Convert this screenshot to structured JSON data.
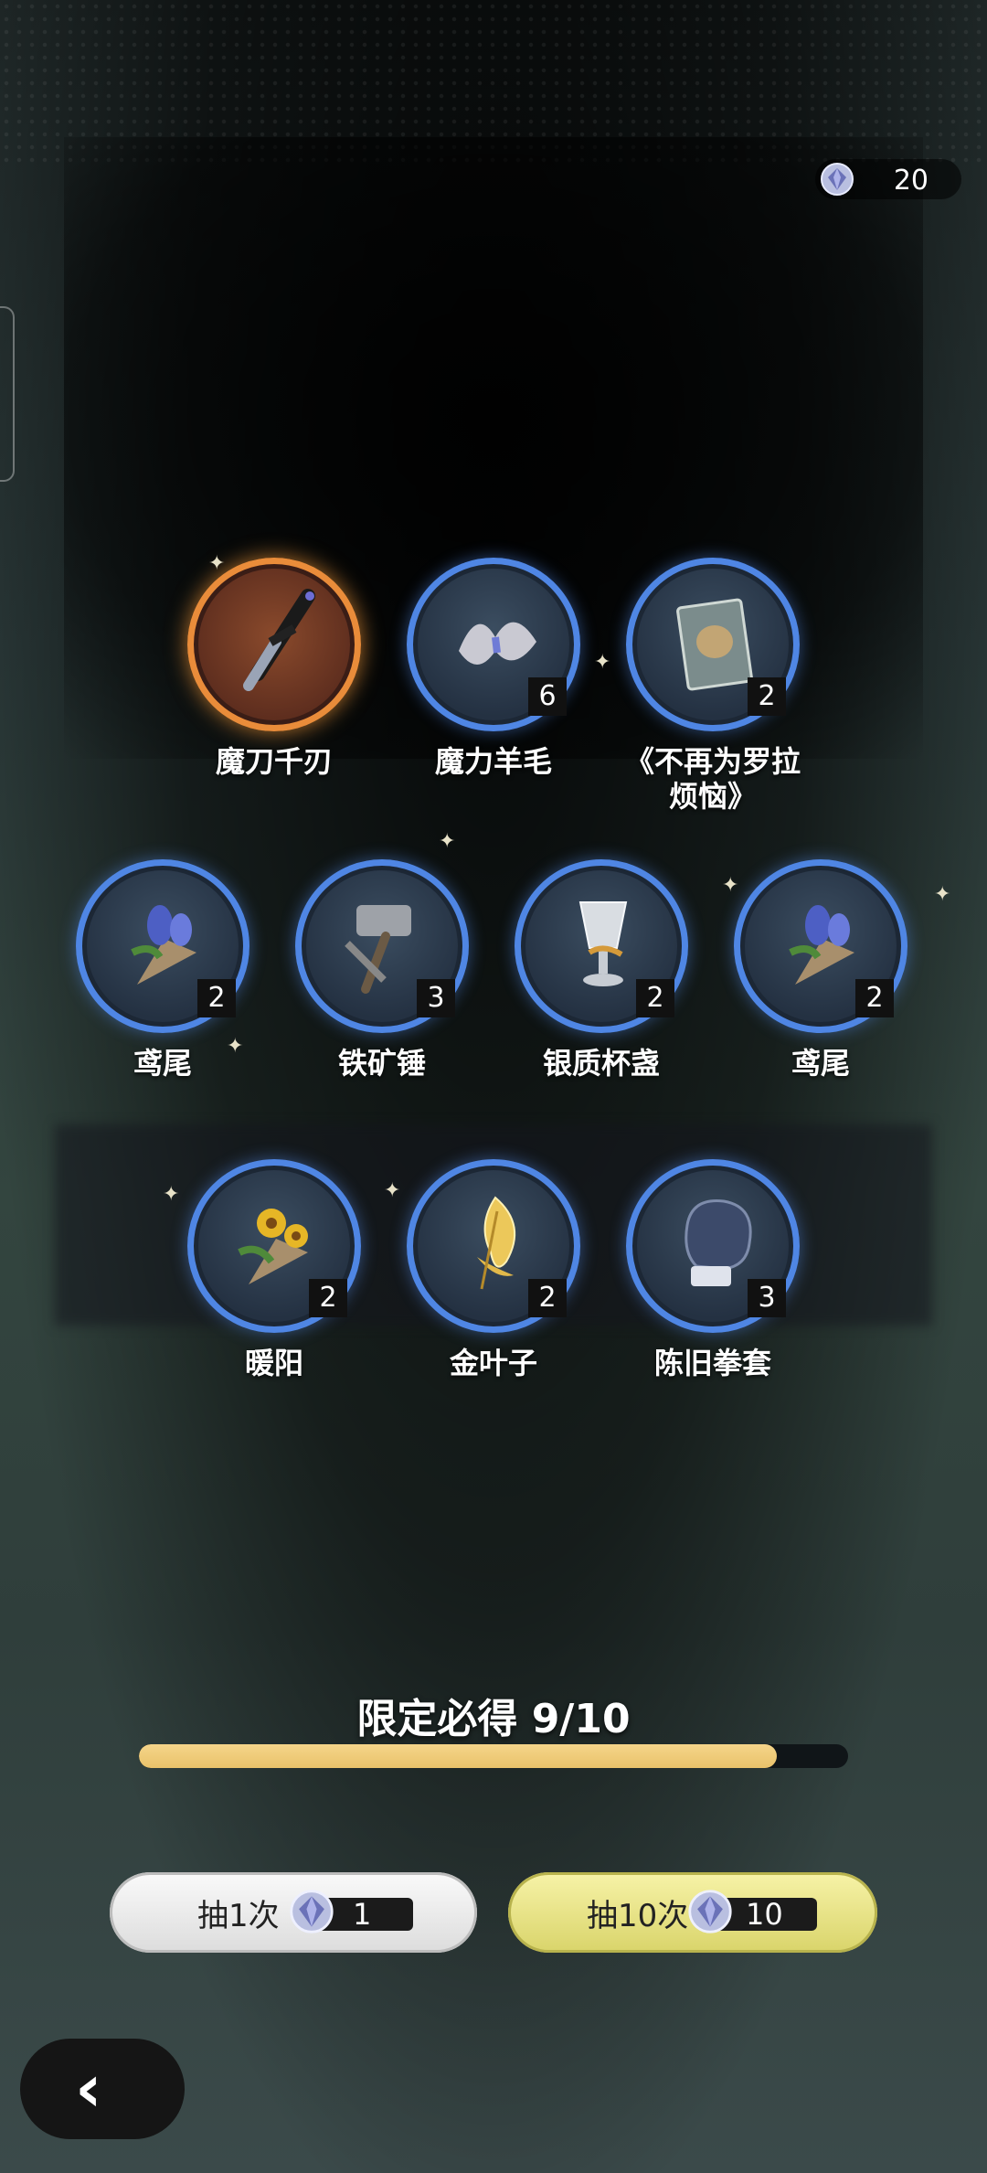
{
  "currency": {
    "icon": "crystal-gem-icon",
    "value": "20"
  },
  "items": [
    {
      "name": "魔刀千刃",
      "count": "",
      "rarity": "gold",
      "icon": "sword-icon"
    },
    {
      "name": "魔力羊毛",
      "count": "6",
      "rarity": "blue",
      "icon": "wool-icon"
    },
    {
      "name": "《不再为罗拉\n烦恼》",
      "count": "2",
      "rarity": "blue",
      "icon": "book-icon"
    },
    {
      "name": "鸢尾",
      "count": "2",
      "rarity": "blue",
      "icon": "iris-bouquet-icon"
    },
    {
      "name": "铁矿锤",
      "count": "3",
      "rarity": "blue",
      "icon": "hammer-icon"
    },
    {
      "name": "银质杯盏",
      "count": "2",
      "rarity": "blue",
      "icon": "silver-goblet-icon"
    },
    {
      "name": "鸢尾",
      "count": "2",
      "rarity": "blue",
      "icon": "iris-bouquet-icon"
    },
    {
      "name": "暖阳",
      "count": "2",
      "rarity": "blue",
      "icon": "sunflower-bouquet-icon"
    },
    {
      "name": "金叶子",
      "count": "2",
      "rarity": "blue",
      "icon": "gold-leaf-icon"
    },
    {
      "name": "陈旧拳套",
      "count": "3",
      "rarity": "blue",
      "icon": "boxing-glove-icon"
    }
  ],
  "progress": {
    "label": "限定必得 9/10",
    "fraction": 0.9
  },
  "buttons": {
    "draw_one": {
      "label": "抽1次",
      "cost": "1"
    },
    "draw_ten": {
      "label": "抽10次",
      "cost": "10"
    }
  },
  "back": {
    "label": "‹",
    "icon": "back-arrow-icon"
  },
  "colors": {
    "gold_frame": "#e98c3a",
    "blue_frame": "#4f86e4",
    "progress": "#e9c26a",
    "draw_ten_bg": "#e9e48a"
  }
}
